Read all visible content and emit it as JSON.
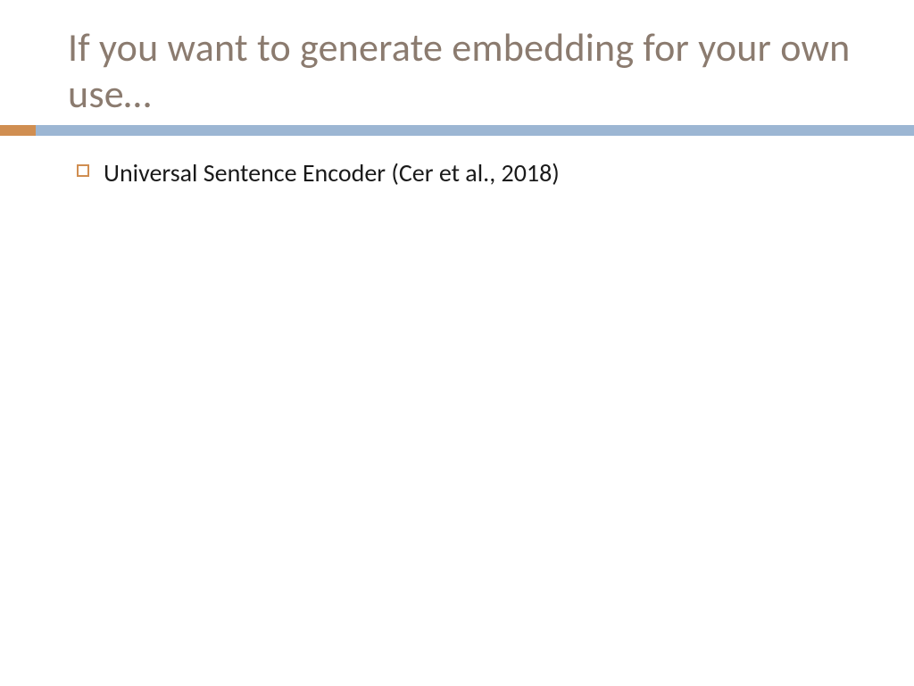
{
  "slide": {
    "title": "If you want to generate embedding for your own use…",
    "bullets": [
      {
        "text": "Universal Sentence Encoder (Cer et al., 2018)"
      }
    ]
  },
  "colors": {
    "title_text": "#8b7b6f",
    "accent_orange": "#d08e51",
    "accent_blue": "#9cb6d3",
    "body_text": "#1a1a1a"
  }
}
